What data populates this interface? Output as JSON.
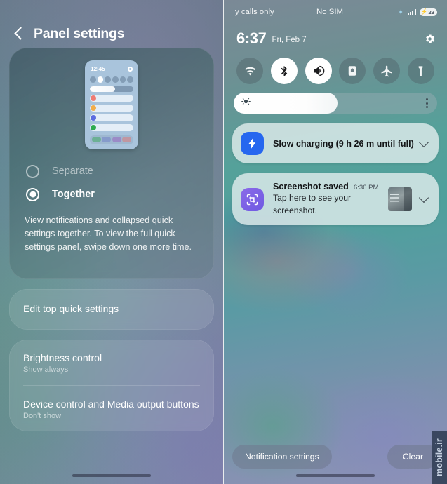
{
  "left": {
    "header": {
      "back_icon": "chevron-left-icon",
      "title": "Panel settings"
    },
    "preview": {
      "time": "12:45",
      "gear_icon": "gear-icon",
      "toggle_dots": 6,
      "active_dot_index": 1,
      "rows": [
        {
          "icon_color": "#ef7b72"
        },
        {
          "icon_color": "#f2ad4a"
        },
        {
          "icon_color": "#5b6ce0"
        },
        {
          "icon_color": "#2eab4f"
        }
      ],
      "tray_chips": [
        "#5fae86",
        "#7f93c9",
        "#9a7fc4",
        "#c98e95"
      ]
    },
    "options": [
      {
        "label": "Separate",
        "selected": false
      },
      {
        "label": "Together",
        "selected": true
      }
    ],
    "description": "View notifications and collapsed quick settings together. To view the full quick settings panel, swipe down one more time.",
    "edit_top_quick_settings": "Edit top quick settings",
    "settings_items": [
      {
        "title": "Brightness control",
        "subtitle": "Show always"
      },
      {
        "title": "Device control and Media output buttons",
        "subtitle": "Don't show"
      }
    ]
  },
  "right": {
    "statusbar": {
      "carrier": "y calls only",
      "sim": "No SIM",
      "bluetooth_icon": "bluetooth-icon",
      "signal_icon": "signal-bars-icon",
      "battery_percent": "23",
      "battery_icon": "battery-charging-icon"
    },
    "clock": {
      "time": "6:37",
      "date": "Fri, Feb 7",
      "settings_icon": "gear-icon"
    },
    "toggles": [
      {
        "name": "wifi-toggle",
        "icon": "wifi-icon",
        "on": false
      },
      {
        "name": "bluetooth-toggle",
        "icon": "bluetooth-icon",
        "on": true
      },
      {
        "name": "sound-toggle",
        "icon": "volume-icon",
        "on": true
      },
      {
        "name": "auto-rotate-toggle",
        "icon": "rotation-lock-icon",
        "on": false
      },
      {
        "name": "airplane-mode-toggle",
        "icon": "airplane-icon",
        "on": false
      },
      {
        "name": "flashlight-toggle",
        "icon": "flashlight-icon",
        "on": false
      }
    ],
    "brightness": {
      "icon": "brightness-icon",
      "value_percent": 56,
      "menu_icon": "more-vertical-icon"
    },
    "notifications": [
      {
        "icon": "charging-bolt-icon",
        "icon_color": "#2667ef",
        "title": "Slow charging (9 h 26 m until full)",
        "time": "",
        "subtitle": "",
        "has_thumbnail": false,
        "expand_icon": "chevron-down-icon"
      },
      {
        "icon": "screenshot-crop-icon",
        "icon_color": "#7a5ee5",
        "title": "Screenshot saved",
        "time": "6:36 PM",
        "subtitle": "Tap here to see your screenshot.",
        "has_thumbnail": true,
        "expand_icon": "chevron-down-icon"
      }
    ],
    "bottom": {
      "notification_settings": "Notification settings",
      "clear": "Clear"
    },
    "watermark": "mobile.ir"
  }
}
